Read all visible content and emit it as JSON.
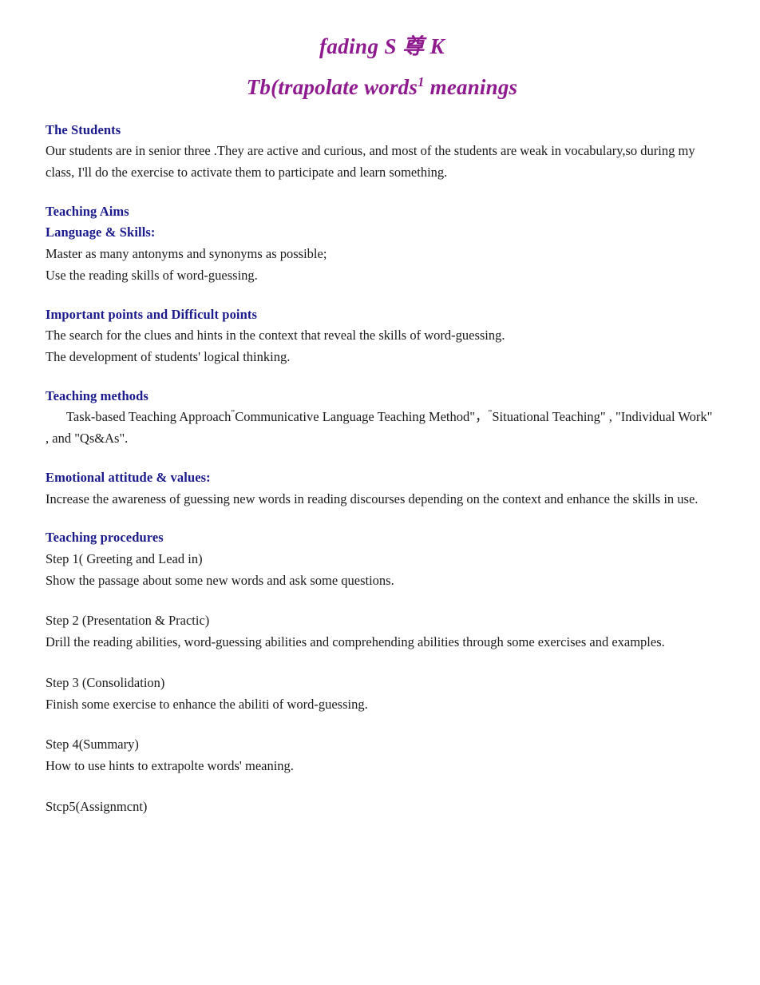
{
  "document": {
    "title_line_1": "fading S 尊 K",
    "title_line_2_before": "Tb(trapolate words",
    "title_line_2_sup": "1",
    "title_line_2_after": " meanings",
    "colors": {
      "title_purple": "#8f1a8f",
      "heading_blue": "#1a1a8c",
      "body_black": "#1a1a1a",
      "page_background": "#ffffff"
    }
  },
  "sections": {
    "students": {
      "heading": "The Students",
      "body": "Our students are in senior three .They are active and curious, and most of the students are weak in vocabulary,so during my class, I'll do the exercise to activate them to participate and learn something."
    },
    "teaching_aims": {
      "heading": "Teaching Aims",
      "subheading": "Language & Skills:",
      "line_1": "Master as many antonyms and synonyms as possible;",
      "line_2": "Use the reading skills of word-guessing."
    },
    "important_points": {
      "heading": "Important points and Difficult points",
      "line_1": "The search for the clues and hints in the context that reveal the skills of word-guessing.",
      "line_2": "The development of students' logical thinking."
    },
    "teaching_methods": {
      "heading": "Teaching methods",
      "body_part_1": "Task-based Teaching Approach",
      "raised_quote_1": "\"",
      "body_part_2": "Communicative Language Teaching Method\"，",
      "raised_quote_2": "\"",
      "body_part_3": "Situational Teaching\" , \"Individual Work\" , and \"Qs&As\"."
    },
    "emotional_attitude": {
      "heading": "Emotional attitude & values:",
      "body": "Increase the awareness of guessing new words in reading discourses depending on the context and enhance the skills in use."
    },
    "teaching_procedures": {
      "heading": "Teaching procedures",
      "steps": [
        {
          "title": "Step 1( Greeting and Lead in)",
          "body": "Show the passage about some new words and ask some questions."
        },
        {
          "title": "Step 2 (Presentation & Practic)",
          "body": "Drill the reading abilities, word-guessing abilities and comprehending abilities through some exercises and examples."
        },
        {
          "title": "Step 3 (Consolidation)",
          "body": "Finish some exercise to enhance the abiliti of word-guessing."
        },
        {
          "title": "Step 4(Summary)",
          "body": "How to use hints to extrapolte words' meaning."
        },
        {
          "title": "Stcp5(Assignmcnt)",
          "body": ""
        }
      ]
    }
  }
}
